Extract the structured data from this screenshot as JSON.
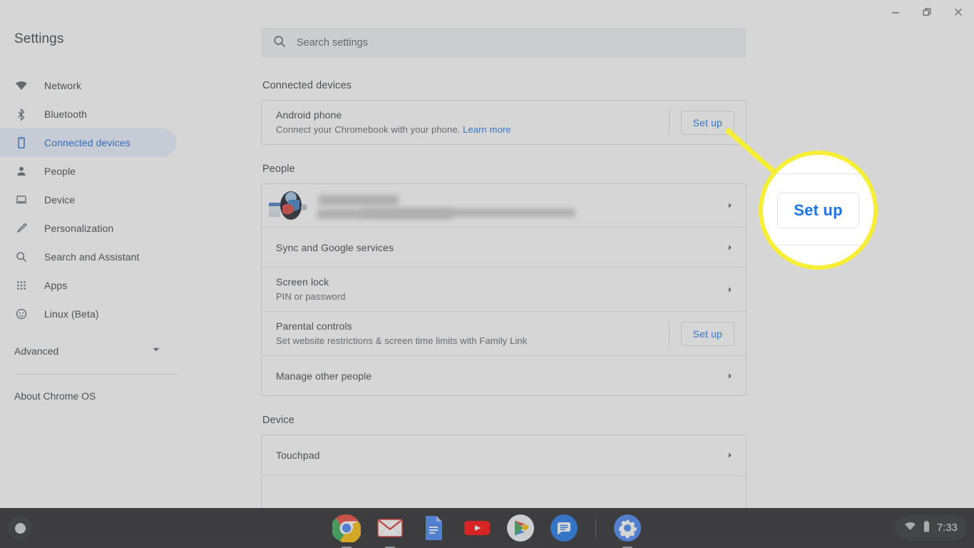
{
  "window": {
    "minimize_label": "Minimize",
    "restore_label": "Restore",
    "close_label": "Close"
  },
  "header": {
    "app_title": "Settings",
    "search_placeholder": "Search settings",
    "search_value": "",
    "search_icon": "search-icon"
  },
  "sidebar": {
    "items": [
      {
        "label": "Network",
        "icon": "wifi-icon",
        "selected": false
      },
      {
        "label": "Bluetooth",
        "icon": "bluetooth-icon",
        "selected": false
      },
      {
        "label": "Connected devices",
        "icon": "phone-icon",
        "selected": true
      },
      {
        "label": "People",
        "icon": "person-icon",
        "selected": false
      },
      {
        "label": "Device",
        "icon": "laptop-icon",
        "selected": false
      },
      {
        "label": "Personalization",
        "icon": "brush-icon",
        "selected": false
      },
      {
        "label": "Search and Assistant",
        "icon": "search-icon",
        "selected": false
      },
      {
        "label": "Apps",
        "icon": "grid-icon",
        "selected": false
      },
      {
        "label": "Linux (Beta)",
        "icon": "linux-penguin-icon",
        "selected": false
      }
    ],
    "advanced_label": "Advanced",
    "advanced_icon": "chevron-down-icon",
    "about_label": "About Chrome OS"
  },
  "main": {
    "sections": [
      {
        "title": "Connected devices",
        "rows": [
          {
            "title": "Android phone",
            "sub_before_link": "Connect your Chromebook with your phone.",
            "link_label": "Learn more",
            "action": "Set up",
            "action_type": "button"
          }
        ]
      },
      {
        "title": "People",
        "rows": [
          {
            "title": "",
            "sub_before_link": "",
            "action_type": "chevron",
            "redacted": true,
            "avatar_icon": "avatar"
          },
          {
            "title": "Sync and Google services",
            "sub_before_link": "",
            "action_type": "chevron"
          },
          {
            "title": "Screen lock",
            "sub_before_link": "PIN or password",
            "action_type": "chevron"
          },
          {
            "title": "Parental controls",
            "sub_before_link": "Set website restrictions & screen time limits with Family Link",
            "action": "Set up",
            "action_type": "button"
          },
          {
            "title": "Manage other people",
            "sub_before_link": "",
            "action_type": "chevron"
          }
        ]
      },
      {
        "title": "Device",
        "rows": [
          {
            "title": "Touchpad",
            "sub_before_link": "",
            "action_type": "chevron"
          }
        ]
      }
    ]
  },
  "callout": {
    "label": "Set up",
    "ring_color": "#f7ee36"
  },
  "shelf": {
    "launcher_icon": "launcher-icon",
    "apps": [
      {
        "name": "chrome-icon",
        "label": "Chrome",
        "running": true
      },
      {
        "name": "gmail-icon",
        "label": "Gmail",
        "running": true
      },
      {
        "name": "docs-icon",
        "label": "Docs",
        "running": false
      },
      {
        "name": "youtube-icon",
        "label": "YouTube",
        "running": false
      },
      {
        "name": "play-store-icon",
        "label": "Play Store",
        "running": false
      },
      {
        "name": "messages-icon",
        "label": "Messages",
        "running": false
      },
      {
        "name": "settings-icon",
        "label": "Settings",
        "running": true
      }
    ],
    "tray": {
      "wifi_icon": "wifi-icon",
      "battery_icon": "battery-icon",
      "time": "7:33"
    }
  },
  "colors": {
    "accent_blue": "#1a73e8",
    "selected_blue": "#1967d2",
    "selected_pill": "#e8f0fe",
    "text_primary": "#3c4043",
    "text_secondary": "#5f6368",
    "border": "#dadce0",
    "shelf_bg": "#202124",
    "callout_yellow": "#f7ee36"
  }
}
